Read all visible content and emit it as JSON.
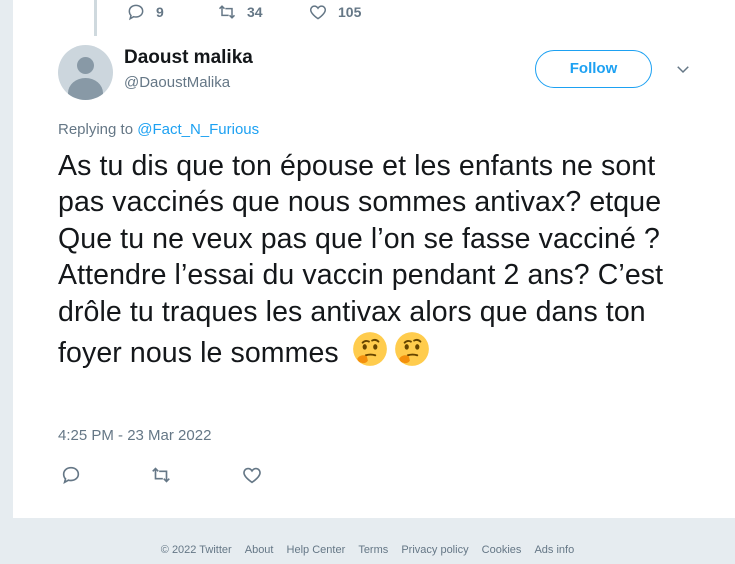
{
  "previous_tweet": {
    "reply_count": "9",
    "retweet_count": "34",
    "like_count": "105"
  },
  "tweet": {
    "display_name": "Daoust malika",
    "handle": "@DaoustMalika",
    "follow_label": "Follow",
    "replying_prefix": "Replying to",
    "replying_to": "@Fact_N_Furious",
    "text": "As tu dis que ton épouse et les enfants ne sont pas vaccinés que nous sommes antivax? etque Que tu ne veux pas que l’on se fasse vacciné ? Attendre l’essai du vaccin pendant 2 ans? C’est drôle tu traques les antivax alors que dans ton foyer nous le sommes",
    "emojis": [
      "thinking-face",
      "thinking-face"
    ],
    "timestamp": "4:25 PM - 23 Mar 2022"
  },
  "footer": {
    "links": [
      "© 2022 Twitter",
      "About",
      "Help Center",
      "Terms",
      "Privacy policy",
      "Cookies",
      "Ads info"
    ]
  },
  "colors": {
    "accent": "#1da1f2",
    "muted": "#657786",
    "background": "#e6ecf0"
  }
}
